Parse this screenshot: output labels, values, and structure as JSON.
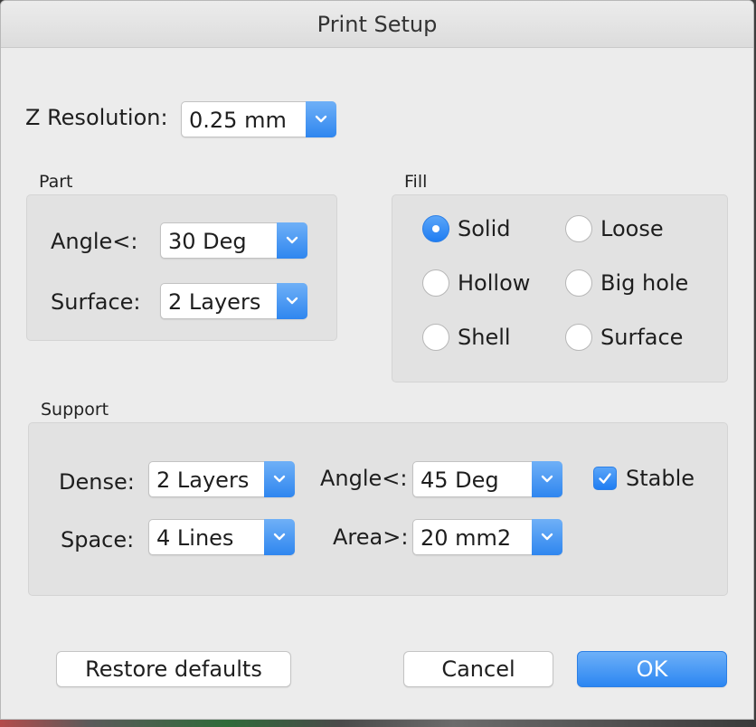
{
  "window": {
    "title": "Print Setup"
  },
  "z_resolution": {
    "label": "Z Resolution:",
    "value": "0.25 mm"
  },
  "part": {
    "group_label": "Part",
    "angle": {
      "label": "Angle<:",
      "value": "30 Deg"
    },
    "surface": {
      "label": "Surface:",
      "value": "2 Layers"
    }
  },
  "fill": {
    "group_label": "Fill",
    "selected": "Solid",
    "options": [
      "Solid",
      "Loose",
      "Hollow",
      "Big hole",
      "Shell",
      "Surface"
    ]
  },
  "support": {
    "group_label": "Support",
    "dense": {
      "label": "Dense:",
      "value": "2 Layers"
    },
    "space": {
      "label": "Space:",
      "value": "4 Lines"
    },
    "angle": {
      "label": "Angle<:",
      "value": "45 Deg"
    },
    "area": {
      "label": "Area>:",
      "value": "20 mm2"
    },
    "stable": {
      "label": "Stable",
      "checked": true
    }
  },
  "buttons": {
    "restore_defaults": "Restore defaults",
    "cancel": "Cancel",
    "ok": "OK"
  },
  "colors": {
    "accent": "#2f86ef",
    "window_bg": "#ececec",
    "group_bg": "#e2e2e2"
  },
  "icons": {
    "popup_arrow": "chevron-down-icon",
    "checkbox_mark": "checkmark-icon"
  }
}
